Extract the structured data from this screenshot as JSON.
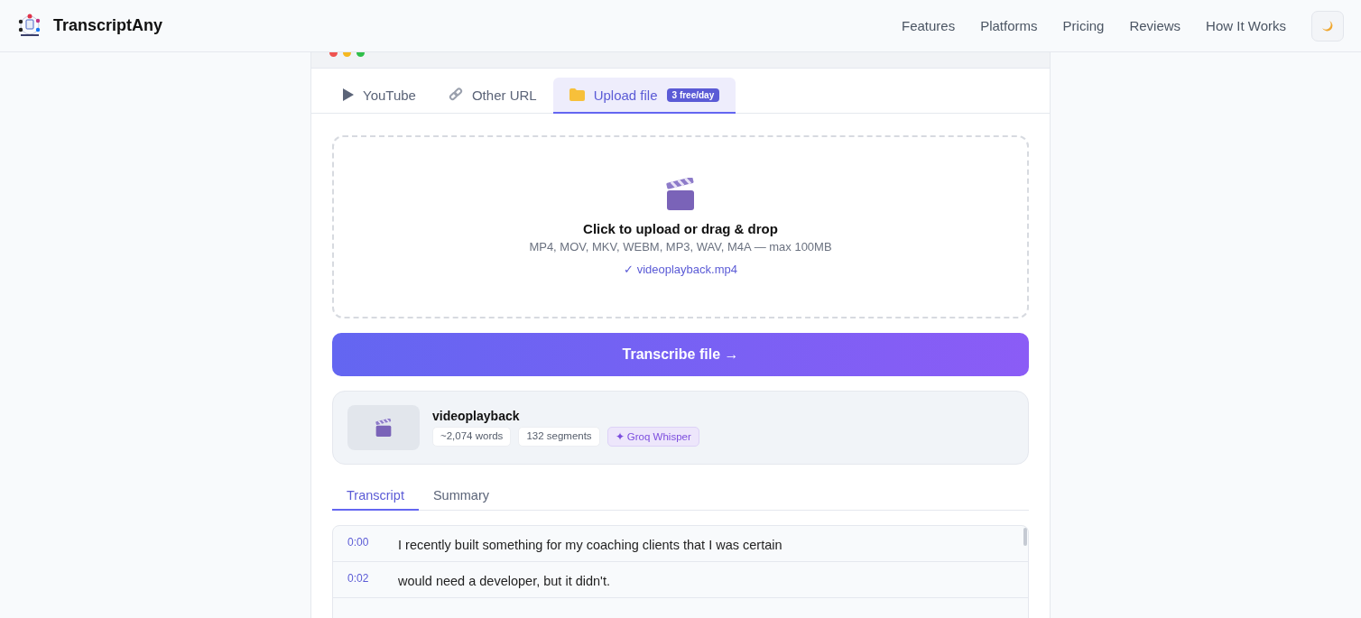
{
  "header": {
    "brand": "TranscriptAny",
    "nav": [
      {
        "label": "Features"
      },
      {
        "label": "Platforms"
      },
      {
        "label": "Pricing"
      },
      {
        "label": "Reviews"
      },
      {
        "label": "How It Works"
      }
    ]
  },
  "source_tabs": [
    {
      "kind": "play",
      "label": "YouTube",
      "selected": false
    },
    {
      "kind": "link",
      "label": "Other URL",
      "selected": false
    },
    {
      "kind": "folder",
      "label": "Upload file",
      "badge": "3 free/day",
      "selected": true
    }
  ],
  "dropzone": {
    "title": "Click to upload or drag & drop",
    "formats": "MP4, MOV, MKV, WEBM, MP3, WAV, M4A — max 100MB",
    "file": "✓ videoplayback.mp4"
  },
  "transcribe_button": "Transcribe file →",
  "result": {
    "title": "videoplayback",
    "tags": [
      {
        "kind": "plain",
        "label": "~2,074 words"
      },
      {
        "kind": "plain",
        "label": "132 segments"
      },
      {
        "kind": "engine",
        "label": "✦ Groq Whisper"
      }
    ]
  },
  "view_tabs": [
    {
      "label": "Transcript",
      "selected": true
    },
    {
      "label": "Summary",
      "selected": false
    }
  ],
  "segments": [
    {
      "time": "0:00",
      "text": "I recently built something for my coaching clients that I was certain"
    },
    {
      "time": "0:02",
      "text": "would need a developer, but it didn't."
    }
  ]
}
